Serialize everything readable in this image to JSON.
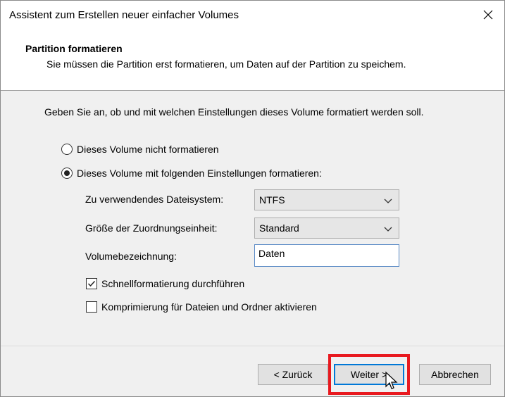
{
  "window": {
    "title": "Assistent zum Erstellen neuer einfacher Volumes"
  },
  "header": {
    "title": "Partition formatieren",
    "subtitle": "Sie müssen die Partition erst formatieren, um Daten auf der Partition zu speichem."
  },
  "body": {
    "lead": "Geben Sie an, ob und mit welchen Einstellungen dieses Volume formatiert werden soll.",
    "options": [
      {
        "label": "Dieses Volume nicht formatieren",
        "selected": false
      },
      {
        "label": "Dieses Volume mit folgenden Einstellungen formatieren:",
        "selected": true
      }
    ],
    "fields": {
      "filesystem": {
        "label": "Zu verwendendes Dateisystem:",
        "value": "NTFS"
      },
      "allocation": {
        "label": "Größe der Zuordnungseinheit:",
        "value": "Standard"
      },
      "volume_label": {
        "label": "Volumebezeichnung:",
        "value": "Daten"
      }
    },
    "checkboxes": [
      {
        "label": "Schnellformatierung durchführen",
        "checked": true
      },
      {
        "label": "Komprimierung für Dateien und Ordner aktivieren",
        "checked": false
      }
    ]
  },
  "footer": {
    "back_label": "< Zurück",
    "next_label": "Weiter >",
    "cancel_label": "Abbrechen"
  },
  "colors": {
    "highlight": "#e8191f",
    "focus_border": "#0078d7"
  }
}
